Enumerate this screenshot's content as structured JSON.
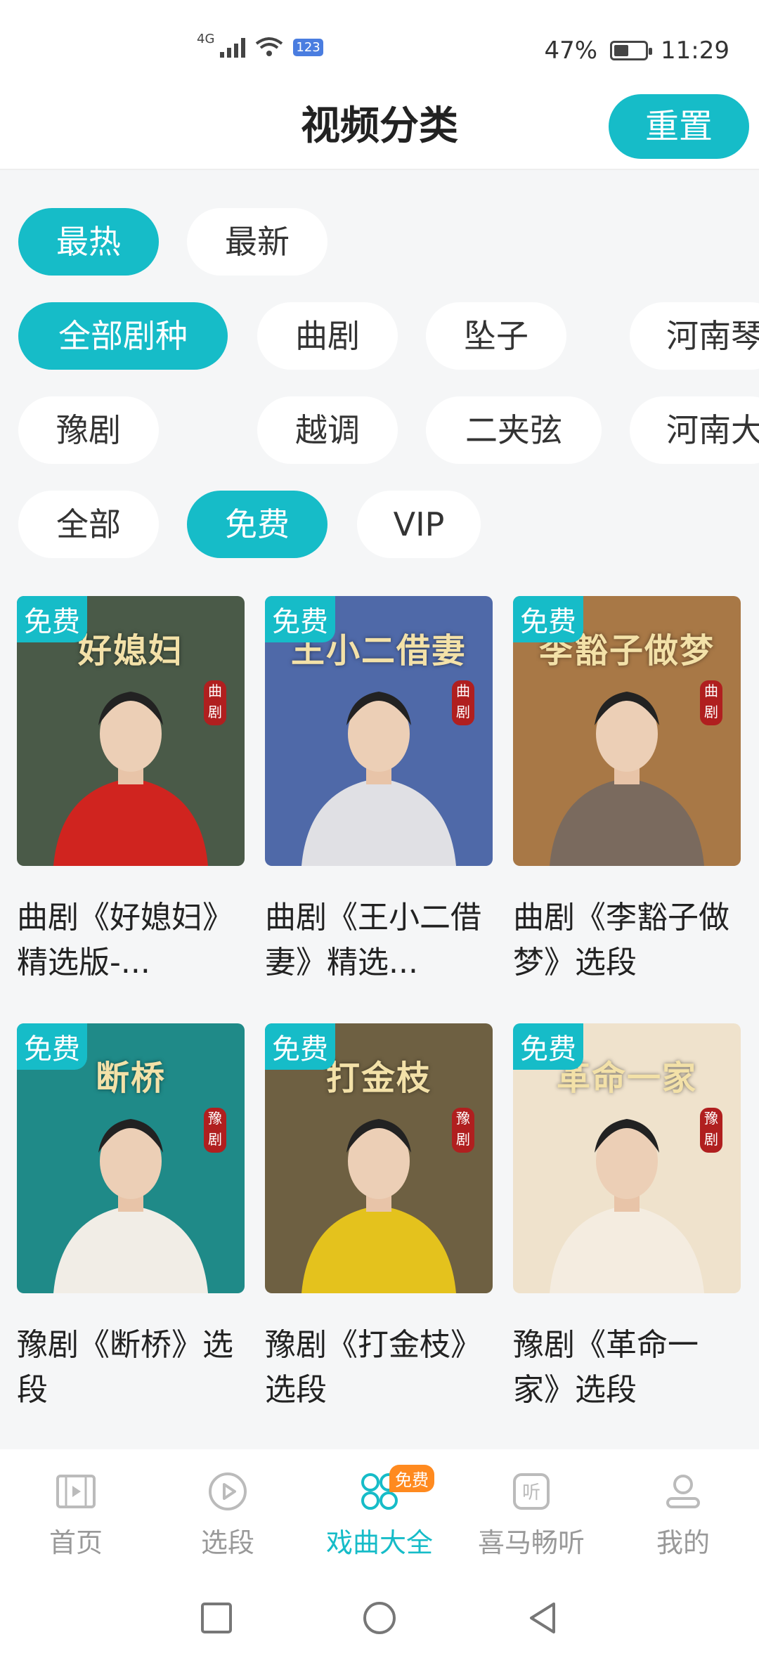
{
  "status_bar": {
    "network": "4G",
    "wifi_badge": "123",
    "battery": "47%",
    "battery_level": 0.47,
    "time": "11:29"
  },
  "header": {
    "title": "视频分类",
    "reset_label": "重置"
  },
  "filters": {
    "sort": [
      {
        "label": "最热",
        "active": true
      },
      {
        "label": "最新",
        "active": false
      }
    ],
    "genres_row1": [
      {
        "label": "全部剧种",
        "active": true
      },
      {
        "label": "曲剧",
        "active": false
      },
      {
        "label": "坠子",
        "active": false
      },
      {
        "label": "河南琴",
        "active": false
      }
    ],
    "genres_row2": [
      {
        "label": "豫剧",
        "active": false
      },
      {
        "label": "越调",
        "active": false
      },
      {
        "label": "二夹弦",
        "active": false
      },
      {
        "label": "河南大",
        "active": false
      }
    ],
    "price": [
      {
        "label": "全部",
        "active": false
      },
      {
        "label": "免费",
        "active": true
      },
      {
        "label": "VIP",
        "active": false
      }
    ]
  },
  "videos": [
    {
      "badge": "免费",
      "thumb_title": "好媳妇",
      "seal": "曲剧",
      "caption": "曲剧《好媳妇》精选版-...",
      "bg": "#4a5a48",
      "costume": "#d0241f"
    },
    {
      "badge": "免费",
      "thumb_title": "王小二借妻",
      "seal": "曲剧",
      "caption": "曲剧《王小二借妻》精选...",
      "bg": "#4f69a8",
      "costume": "#e0e0e4"
    },
    {
      "badge": "免费",
      "thumb_title": "李豁子做梦",
      "seal": "曲剧",
      "caption": "曲剧《李豁子做梦》选段",
      "bg": "#a87846",
      "costume": "#7a6a5e"
    },
    {
      "badge": "免费",
      "thumb_title": "断桥",
      "seal": "豫剧",
      "caption": "豫剧《断桥》选段",
      "bg": "#1f8a88",
      "costume": "#f1ede6"
    },
    {
      "badge": "免费",
      "thumb_title": "打金枝",
      "seal": "豫剧",
      "caption": "豫剧《打金枝》选段",
      "bg": "#6e6042",
      "costume": "#e4c21d"
    },
    {
      "badge": "免费",
      "thumb_title": "革命一家",
      "seal": "豫剧",
      "caption": "豫剧《革命一家》选段",
      "bg": "#efe2cc",
      "costume": "#f4ece0"
    }
  ],
  "tabbar": [
    {
      "label": "首页",
      "icon": "film-icon",
      "active": false
    },
    {
      "label": "选段",
      "icon": "play-circle-icon",
      "active": false
    },
    {
      "label": "戏曲大全",
      "icon": "grid-icon",
      "active": true,
      "tag": "免费"
    },
    {
      "label": "喜马畅听",
      "icon": "listen-icon",
      "active": false
    },
    {
      "label": "我的",
      "icon": "user-icon",
      "active": false
    }
  ],
  "colors": {
    "accent": "#16bcc8",
    "free_tag": "#ff8a1f",
    "seal_red": "#b01f1f"
  }
}
